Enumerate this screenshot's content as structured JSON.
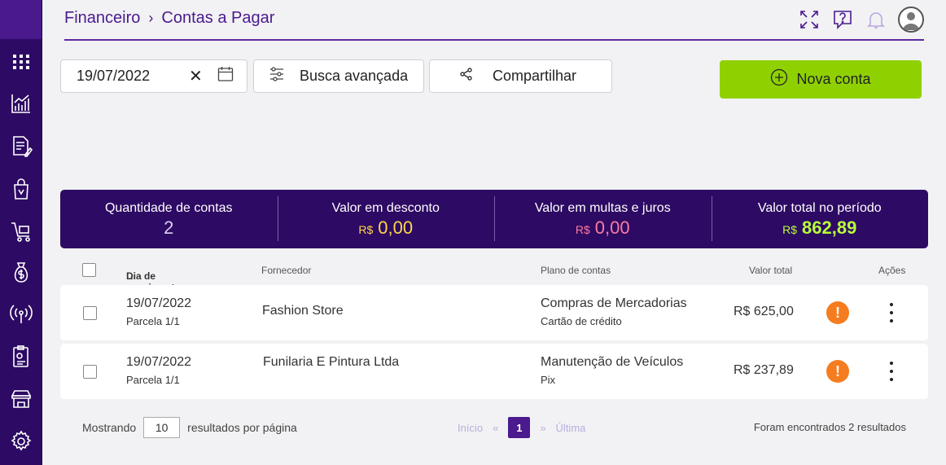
{
  "breadcrumb": {
    "section": "Financeiro",
    "separator": "›",
    "page": "Contas a Pagar"
  },
  "toolbar": {
    "date_value": "19/07/2022",
    "clear_label": "✕",
    "advanced_search_label": "Busca avançada",
    "share_label": "Compartilhar",
    "new_account_label": "Nova conta"
  },
  "summary": {
    "count_label": "Quantidade de contas",
    "count_value": "2",
    "discount_label": "Valor em desconto",
    "discount_currency": "R$",
    "discount_value": "0,00",
    "fines_label": "Valor em multas e juros",
    "fines_currency": "R$",
    "fines_value": "0,00",
    "total_label": "Valor total no período",
    "total_currency": "R$",
    "total_value": "862,89"
  },
  "table": {
    "headers": {
      "due_date": "Dia de vencimento",
      "sort_arrow": "↓",
      "supplier": "Fornecedor",
      "plan": "Plano de contas",
      "total": "Valor total",
      "actions": "Ações"
    },
    "rows": [
      {
        "date": "19/07/2022",
        "installment": "Parcela 1/1",
        "supplier": "Fashion Store",
        "plan": "Compras de Mercadorias",
        "payment": "Cartão de crédito",
        "value": "R$ 625,00",
        "warn": "!"
      },
      {
        "date": "19/07/2022",
        "installment": "Parcela 1/1",
        "supplier": "Funilaria E Pintura Ltda",
        "plan": "Manutenção de Veículos",
        "payment": "Pix",
        "value": "R$ 237,89",
        "warn": "!"
      }
    ]
  },
  "footer": {
    "showing_label": "Mostrando",
    "per_page_value": "10",
    "per_page_label": "resultados por página",
    "pager_first": "Início",
    "pager_prev": "«",
    "pager_current": "1",
    "pager_next": "»",
    "pager_last": "Última",
    "results_text": "Foram encontrados 2 resultados"
  },
  "colors": {
    "sidebar": "#2d0a63",
    "accent": "#4b1a8e",
    "new_button": "#8fd100",
    "warning": "#f57c1f"
  },
  "icons": [
    "apps-grid-icon",
    "chart-icon",
    "document-edit-icon",
    "shopping-bag-icon",
    "cart-icon",
    "money-bag-icon",
    "broadcast-icon",
    "report-icon",
    "store-icon",
    "gear-icon",
    "fullscreen-icon",
    "help-icon",
    "bell-icon",
    "user-avatar-icon",
    "calendar-icon",
    "sliders-icon",
    "share-icon",
    "plus-circle-icon",
    "warning-icon",
    "more-vertical-icon"
  ]
}
